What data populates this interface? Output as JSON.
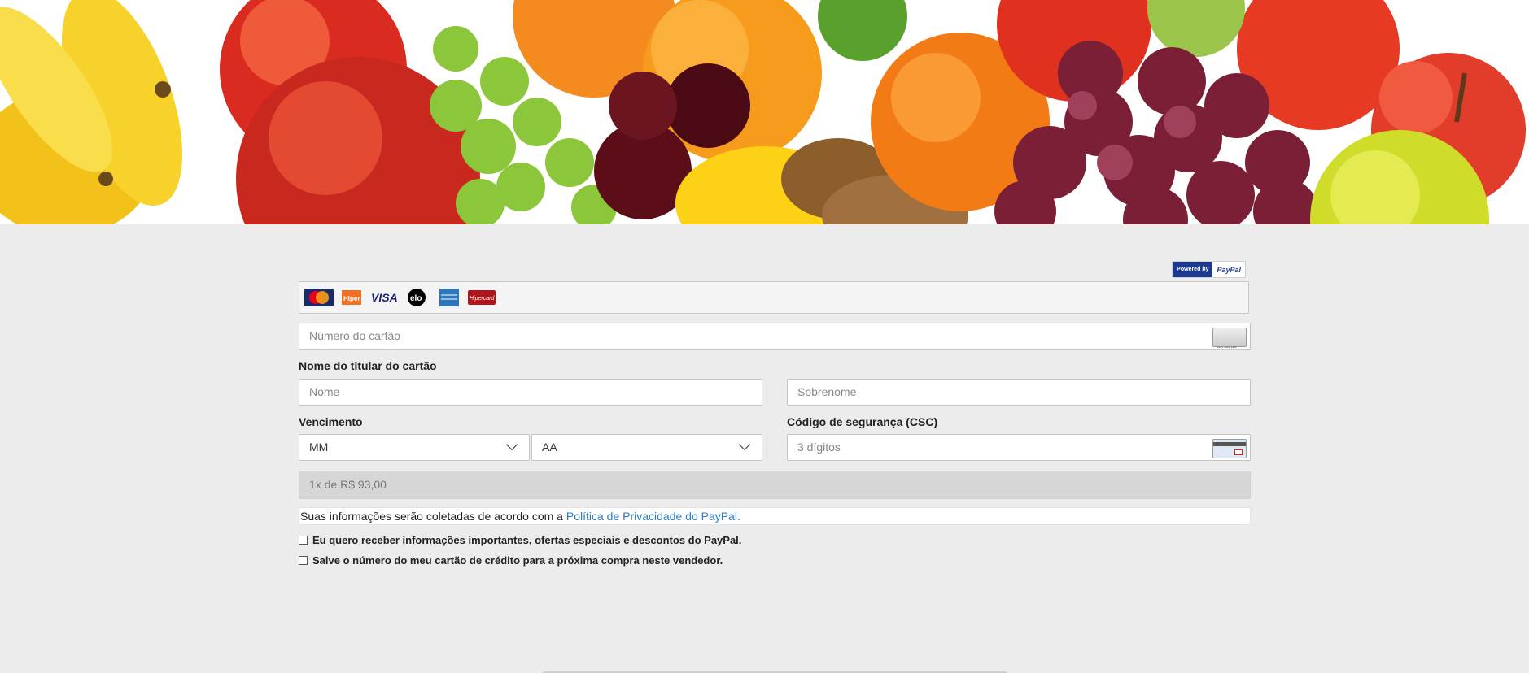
{
  "banner": {
    "alt": "fruit-banner"
  },
  "paypal_badge": {
    "left": "Powered by",
    "right": "PayPal"
  },
  "card_brands": [
    {
      "name": "mastercard",
      "label": "MasterCard",
      "color": "#1a2b6b"
    },
    {
      "name": "hiper",
      "label": "Hiper",
      "color": "#f37021"
    },
    {
      "name": "visa",
      "label": "VISA",
      "color": "#1a1f71"
    },
    {
      "name": "elo",
      "label": "elo",
      "color": "#000000"
    },
    {
      "name": "amex",
      "label": "",
      "color": "#2e77bc"
    },
    {
      "name": "hipercard",
      "label": "Hipercard",
      "color": "#b3131b"
    }
  ],
  "card_number": {
    "placeholder": "Número do cartão"
  },
  "holder": {
    "label": "Nome do titular do cartão",
    "first_placeholder": "Nome",
    "last_placeholder": "Sobrenome"
  },
  "expiry": {
    "label": "Vencimento",
    "month": "MM",
    "year": "AA"
  },
  "csc": {
    "label": "Código de segurança (CSC)",
    "placeholder": "3 dígitos"
  },
  "installments": {
    "value": "1x de R$ 93,00"
  },
  "privacy": {
    "text": "Suas informações serão coletadas de acordo com a ",
    "link": "Política de Privacidade do PayPal."
  },
  "checkboxes": [
    {
      "label": "Eu quero receber informações importantes, ofertas especiais e descontos do PayPal.",
      "checked": false
    },
    {
      "label": "Salve o número do meu cartão de crédito para a próxima compra neste vendedor.",
      "checked": false
    }
  ]
}
